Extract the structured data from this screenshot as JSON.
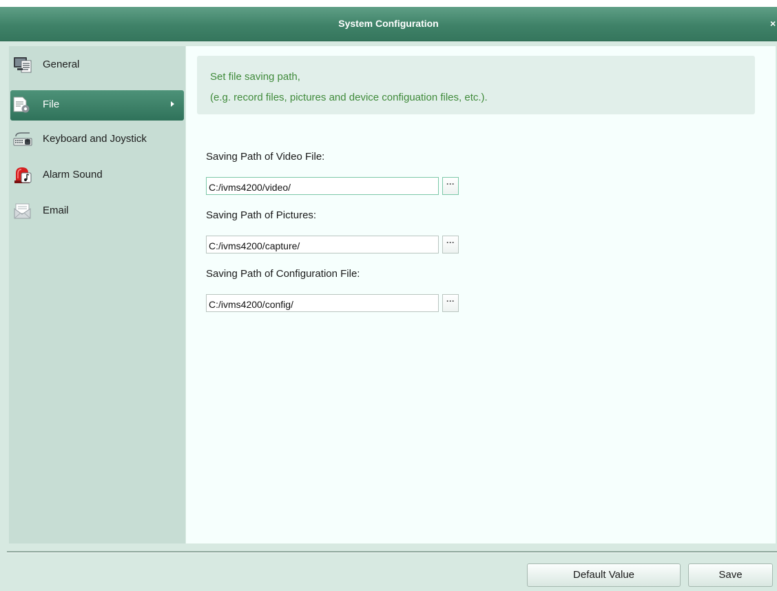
{
  "window": {
    "title": "System Configuration",
    "close_glyph": "×"
  },
  "sidebar": {
    "items": [
      {
        "label": "General",
        "icon": "monitor-icon",
        "active": false
      },
      {
        "label": "File",
        "icon": "file-settings-icon",
        "active": true
      },
      {
        "label": "Keyboard and Joystick",
        "icon": "keyboard-icon",
        "active": false
      },
      {
        "label": "Alarm Sound",
        "icon": "alarm-siren-icon",
        "active": false
      },
      {
        "label": "Email",
        "icon": "envelope-icon",
        "active": false
      }
    ]
  },
  "content": {
    "info": {
      "line1": "Set file saving path,",
      "line2": "(e.g. record files, pictures and device configuation files, etc.)."
    },
    "fields": [
      {
        "label": "Saving Path of Video File:",
        "value": "C:/ivms4200/video/",
        "browse": "···"
      },
      {
        "label": "Saving Path of Pictures:",
        "value": "C:/ivms4200/capture/",
        "browse": "···"
      },
      {
        "label": "Saving Path of Configuration File:",
        "value": "C:/ivms4200/config/",
        "browse": "···"
      }
    ]
  },
  "footer": {
    "default_label": "Default Value",
    "save_label": "Save"
  },
  "colors": {
    "titlebar": "#3f8268",
    "sidebar_active": "#2f725a",
    "info_text": "#3f8a3a",
    "window_bg": "#d7e9e1"
  }
}
